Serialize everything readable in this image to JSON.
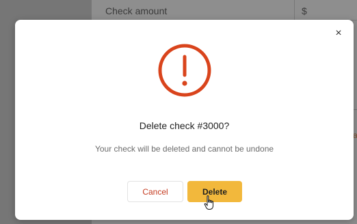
{
  "background": {
    "field_label": "Check amount",
    "currency_symbol": "$",
    "edge_letter": "a"
  },
  "dialog": {
    "close_symbol": "×",
    "title": "Delete check #3000?",
    "message": "Your check will be deleted and cannot be undone",
    "cancel_label": "Cancel",
    "delete_label": "Delete",
    "icon": "exclamation-circle-icon",
    "colors": {
      "warning": "#d9441c",
      "delete_button": "#f2b83c",
      "cancel_text": "#c53b20"
    }
  }
}
